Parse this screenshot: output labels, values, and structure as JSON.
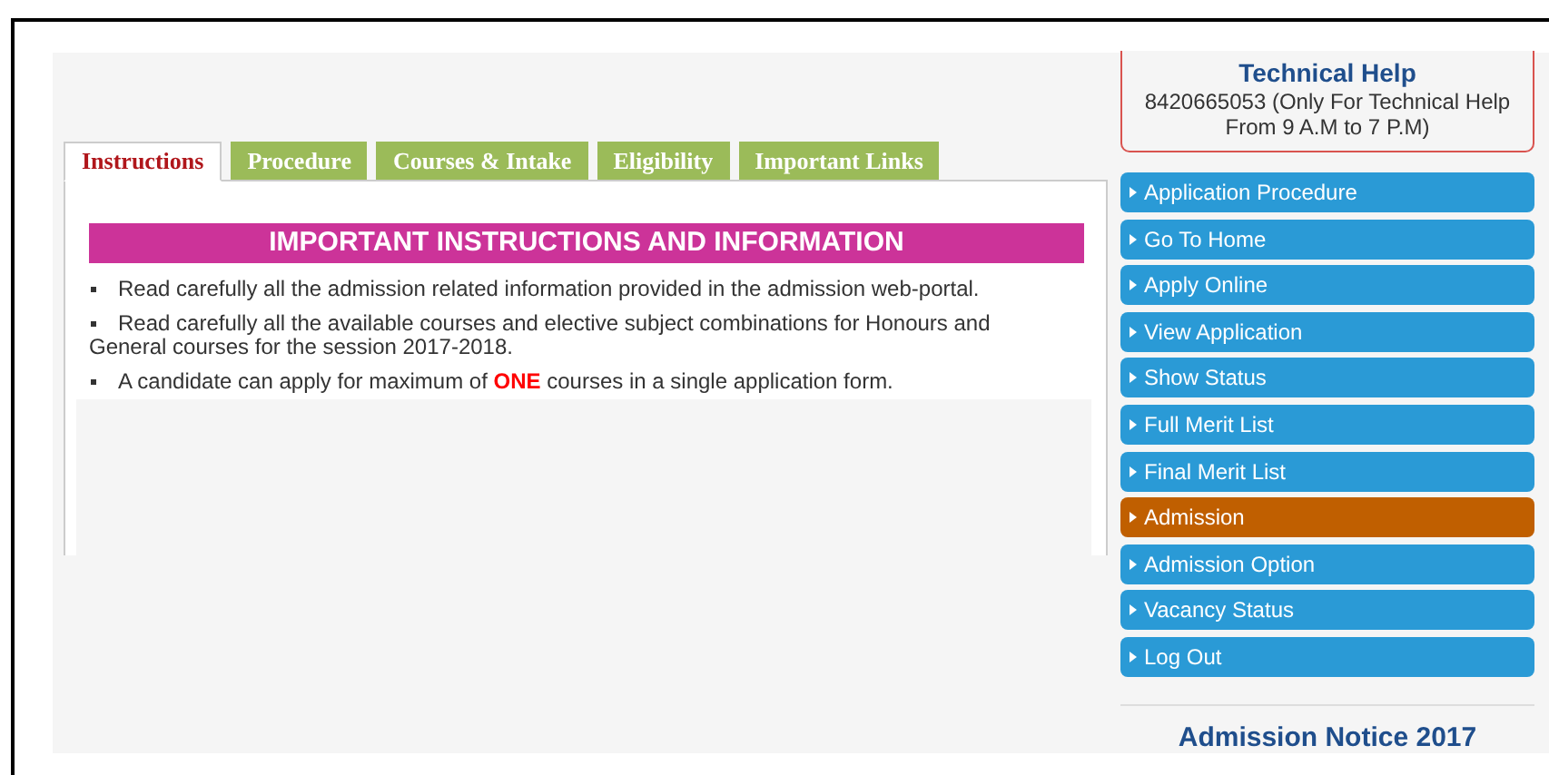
{
  "tabs": [
    {
      "label": "Instructions",
      "selected": true
    },
    {
      "label": "Procedure",
      "selected": false
    },
    {
      "label": "Courses & Intake",
      "selected": false
    },
    {
      "label": "Eligibility",
      "selected": false
    },
    {
      "label": "Important Links",
      "selected": false
    }
  ],
  "panel": {
    "heading": "IMPORTANT INSTRUCTIONS AND INFORMATION",
    "items": [
      {
        "segments": [
          {
            "text": "Read carefully all the admission related information provided in the admission web-portal.",
            "emphasis": false
          }
        ]
      },
      {
        "segments": [
          {
            "text": "Read carefully all the available courses and elective subject combinations for Honours and General courses for the session 2017-2018.",
            "emphasis": false
          }
        ]
      },
      {
        "segments": [
          {
            "text": "A candidate can apply for maximum of ",
            "emphasis": false
          },
          {
            "text": "ONE",
            "emphasis": true
          },
          {
            "text": " courses in a single application form.",
            "emphasis": false
          }
        ]
      }
    ]
  },
  "help": {
    "title": "Technical Help",
    "text": "8420665053 (Only For Technical Help From 9 A.M to 7 P.M)"
  },
  "menu": [
    {
      "label": "Application Procedure",
      "selected": false
    },
    {
      "label": "Go To Home",
      "selected": false
    },
    {
      "label": "Apply Online",
      "selected": false
    },
    {
      "label": "View Application",
      "selected": false
    },
    {
      "label": "Show Status",
      "selected": false
    },
    {
      "label": "Full Merit List",
      "selected": false
    },
    {
      "label": "Final Merit List",
      "selected": false
    },
    {
      "label": "Admission",
      "selected": true
    },
    {
      "label": "Admission Option",
      "selected": false
    },
    {
      "label": "Vacancy Status",
      "selected": false
    },
    {
      "label": "Log Out",
      "selected": false
    }
  ],
  "notice": {
    "title": "Admission Notice 2017"
  }
}
